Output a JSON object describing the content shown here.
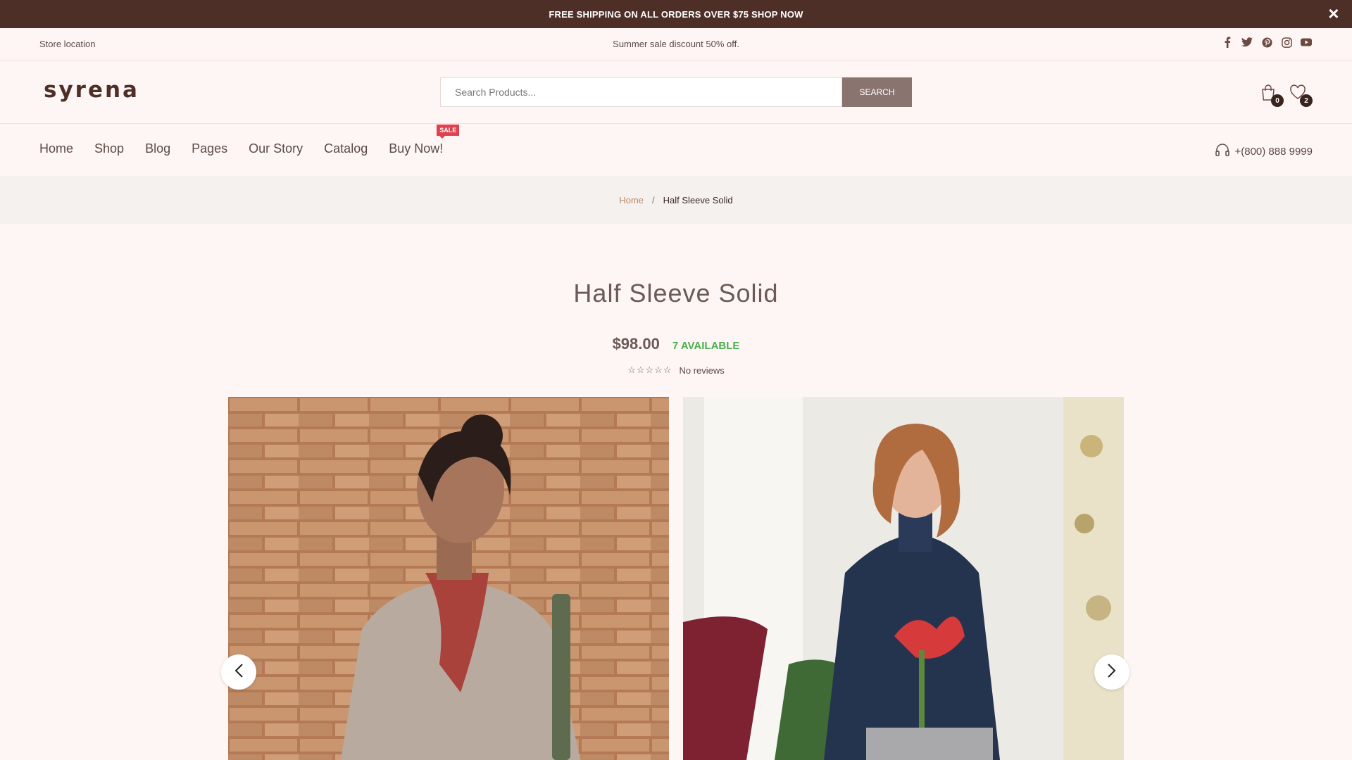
{
  "announcement": {
    "text": "FREE SHIPPING ON ALL ORDERS OVER $75 SHOP NOW"
  },
  "topbar": {
    "store_location": "Store location",
    "promo": "Summer sale discount 50% off."
  },
  "header": {
    "logo": "syrena",
    "search_placeholder": "Search Products...",
    "search_button": "SEARCH",
    "cart_count": "0",
    "wishlist_count": "2"
  },
  "nav": {
    "items": [
      "Home",
      "Shop",
      "Blog",
      "Pages",
      "Our Story",
      "Catalog",
      "Buy Now!"
    ],
    "sale_badge": "SALE",
    "phone": "+(800) 888 9999"
  },
  "breadcrumb": {
    "home": "Home",
    "separator": "/",
    "current": "Half Sleeve Solid"
  },
  "product": {
    "title": "Half Sleeve Solid",
    "price": "$98.00",
    "availability": "7 AVAILABLE",
    "stars": "☆☆☆☆☆",
    "reviews": "No reviews"
  },
  "colors": {
    "accent": "#4e2f28",
    "available": "#4caf50",
    "sale": "#e0414c"
  }
}
